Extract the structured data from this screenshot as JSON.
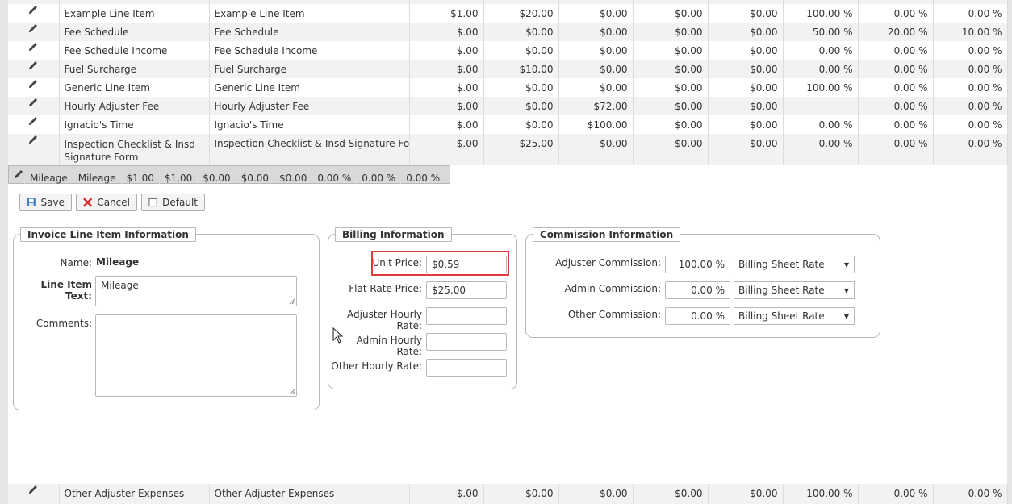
{
  "grid_rows": [
    {
      "name": "Example Line Item",
      "text": "Example Line Item",
      "c1": "$1.00",
      "c2": "$20.00",
      "c3": "$0.00",
      "c4": "$0.00",
      "c5": "$0.00",
      "p1": "100.00 %",
      "p2": "0.00 %",
      "p3": "0.00 %"
    },
    {
      "name": "Fee Schedule",
      "text": "Fee Schedule",
      "c1": "$.00",
      "c2": "$0.00",
      "c3": "$0.00",
      "c4": "$0.00",
      "c5": "$0.00",
      "p1": "50.00 %",
      "p2": "20.00 %",
      "p3": "10.00 %"
    },
    {
      "name": "Fee Schedule Income",
      "text": "Fee Schedule Income",
      "c1": "$.00",
      "c2": "$0.00",
      "c3": "$0.00",
      "c4": "$0.00",
      "c5": "$0.00",
      "p1": "0.00 %",
      "p2": "0.00 %",
      "p3": "0.00 %"
    },
    {
      "name": "Fuel Surcharge",
      "text": "Fuel Surcharge",
      "c1": "$.00",
      "c2": "$10.00",
      "c3": "$0.00",
      "c4": "$0.00",
      "c5": "$0.00",
      "p1": "0.00 %",
      "p2": "0.00 %",
      "p3": "0.00 %"
    },
    {
      "name": "Generic Line Item",
      "text": "Generic Line Item",
      "c1": "$.00",
      "c2": "$0.00",
      "c3": "$0.00",
      "c4": "$0.00",
      "c5": "$0.00",
      "p1": "100.00 %",
      "p2": "0.00 %",
      "p3": "0.00 %"
    },
    {
      "name": "Hourly Adjuster Fee",
      "text": "Hourly Adjuster Fee",
      "c1": "$.00",
      "c2": "$0.00",
      "c3": "$72.00",
      "c4": "$0.00",
      "c5": "$0.00",
      "p1": "",
      "p2": "0.00 %",
      "p3": "0.00 %"
    },
    {
      "name": "Ignacio's Time",
      "text": "Ignacio's Time",
      "c1": "$.00",
      "c2": "$0.00",
      "c3": "$100.00",
      "c4": "$0.00",
      "c5": "$0.00",
      "p1": "0.00 %",
      "p2": "0.00 %",
      "p3": "0.00 %"
    },
    {
      "name": "Inspection Checklist & Insd Signature Form",
      "text": "Inspection Checklist & Insd Signature Form",
      "c1": "$.00",
      "c2": "$25.00",
      "c3": "$0.00",
      "c4": "$0.00",
      "c5": "$0.00",
      "p1": "0.00 %",
      "p2": "0.00 %",
      "p3": "0.00 %"
    },
    {
      "name": "Mileage",
      "text": "Mileage",
      "c1": "$1.00",
      "c2": "$1.00",
      "c3": "$0.00",
      "c4": "$0.00",
      "c5": "$0.00",
      "p1": "0.00 %",
      "p2": "0.00 %",
      "p3": "0.00 %"
    }
  ],
  "bottom_row": {
    "name": "Other Adjuster Expenses",
    "text": "Other Adjuster Expenses",
    "c1": "$.00",
    "c2": "$0.00",
    "c3": "$0.00",
    "c4": "$0.00",
    "c5": "$0.00",
    "p1": "100.00 %",
    "p2": "0.00 %",
    "p3": "0.00 %"
  },
  "toolbar": {
    "save_label": "Save",
    "cancel_label": "Cancel",
    "default_label": "Default"
  },
  "invoice_info": {
    "legend": "Invoice Line Item Information",
    "name_label": "Name:",
    "name_value": "Mileage",
    "text_label": "Line Item Text:",
    "text_value": "Mileage",
    "comments_label": "Comments:",
    "comments_value": ""
  },
  "billing_info": {
    "legend": "Billing Information",
    "unit_price_label": "Unit Price:",
    "unit_price_value": "$0.59",
    "flat_rate_label": "Flat Rate Price:",
    "flat_rate_value": "$25.00",
    "adjuster_hourly_label": "Adjuster Hourly Rate:",
    "adjuster_hourly_value": "",
    "admin_hourly_label": "Admin Hourly Rate:",
    "admin_hourly_value": "",
    "other_hourly_label": "Other Hourly Rate:",
    "other_hourly_value": ""
  },
  "commission_info": {
    "legend": "Commission Information",
    "adjuster_label": "Adjuster Commission:",
    "adjuster_value": "100.00 %",
    "adjuster_select": "Billing Sheet Rate",
    "admin_label": "Admin Commission:",
    "admin_value": "0.00 %",
    "admin_select": "Billing Sheet Rate",
    "other_label": "Other Commission:",
    "other_value": "0.00 %",
    "other_select": "Billing Sheet Rate"
  },
  "colors": {
    "highlight": "#e03c3c",
    "selected_row": "#d9d9d9",
    "alt_row": "#f2f2f2"
  }
}
